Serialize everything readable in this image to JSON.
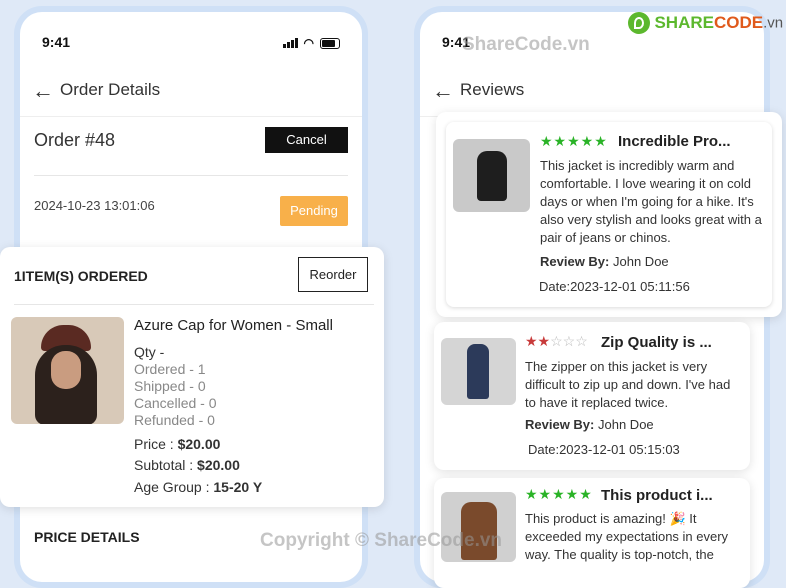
{
  "left_screen": {
    "status_time": "9:41",
    "header_title": "Order Details",
    "order_number": "Order #48",
    "cancel_label": "Cancel",
    "order_date": "2024-10-23 13:01:06",
    "status_badge": "Pending",
    "items_heading": "1ITEM(S) ORDERED",
    "reorder_label": "Reorder",
    "product": {
      "name": "Azure Cap for Women - Small",
      "qty_label": "Qty -",
      "ordered": "Ordered - 1",
      "shipped": "Shipped - 0",
      "cancelled": "Cancelled - 0",
      "refunded": "Refunded - 0",
      "price_label": "Price : ",
      "price_value": "$20.00",
      "subtotal_label": "Subtotal : ",
      "subtotal_value": "$20.00",
      "age_label": "Age Group : ",
      "age_value": "15-20 Y"
    },
    "price_details_heading": "PRICE DETAILS"
  },
  "right_screen": {
    "status_time": "9:41",
    "header_title": "Reviews",
    "reviews": [
      {
        "rating": 5,
        "title": "Incredible Pro...",
        "text": "This jacket is incredibly warm and comfortable. I love wearing it on cold days or when I'm going for a hike. It's also very stylish and looks great with a pair of jeans or chinos.",
        "review_by_label": "Review By:",
        "reviewer": "John Doe",
        "date": "Date:2023-12-01 05:11:56"
      },
      {
        "rating": 2,
        "title": "Zip Quality is ...",
        "text": "The zipper on this jacket is very difficult to zip up and down. I've had to have it replaced twice.",
        "review_by_label": "Review By:",
        "reviewer": "John Doe",
        "date": "Date:2023-12-01 05:15:03"
      },
      {
        "rating": 5,
        "title": "This product i...",
        "text": "This product is amazing! 🎉 It exceeded my expectations in every way. The quality is top-notch, the",
        "review_by_label": "",
        "reviewer": "",
        "date": ""
      }
    ]
  },
  "branding": {
    "logo_text_share": "SHARE",
    "logo_text_code": "CODE",
    "logo_text_tld": ".vn",
    "watermark_top": "ShareCode.vn",
    "watermark_bottom": "Copyright © ShareCode.vn"
  },
  "colors": {
    "accent_dark": "#111111",
    "pending": "#f8b04a",
    "star_green": "#2ab327",
    "star_red": "#c83b3b",
    "background": "#dfe9f7"
  }
}
